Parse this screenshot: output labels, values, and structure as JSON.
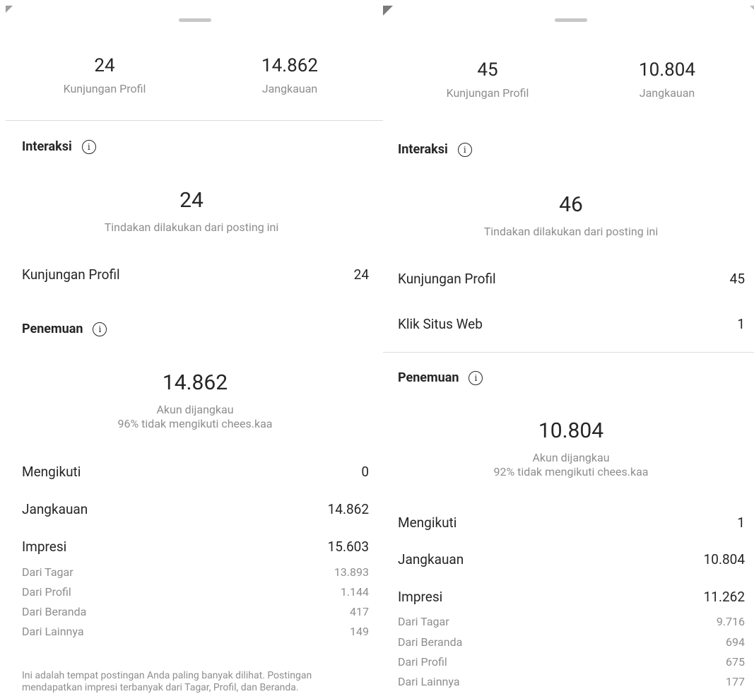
{
  "left": {
    "top_stats": [
      {
        "value": "24",
        "label": "Kunjungan Profil"
      },
      {
        "value": "14.862",
        "label": "Jangkauan"
      }
    ],
    "interaksi": {
      "title": "Interaksi",
      "total": "24",
      "subtitle": "Tindakan dilakukan dari posting ini",
      "rows": [
        {
          "label": "Kunjungan Profil",
          "value": "24"
        }
      ]
    },
    "penemuan": {
      "title": "Penemuan",
      "total": "14.862",
      "subtitle1": "Akun dijangkau",
      "subtitle2": "96% tidak mengikuti chees.kaa",
      "rows": [
        {
          "label": "Mengikuti",
          "value": "0"
        },
        {
          "label": "Jangkauan",
          "value": "14.862"
        },
        {
          "label": "Impresi",
          "value": "15.603"
        }
      ],
      "sub_rows": [
        {
          "label": "Dari Tagar",
          "value": "13.893"
        },
        {
          "label": "Dari Profil",
          "value": "1.144"
        },
        {
          "label": "Dari Beranda",
          "value": "417"
        },
        {
          "label": "Dari Lainnya",
          "value": "149"
        }
      ],
      "note": "Ini adalah tempat postingan Anda paling banyak dilihat. Postingan mendapatkan impresi terbanyak dari Tagar, Profil, dan Beranda."
    }
  },
  "right": {
    "top_stats": [
      {
        "value": "45",
        "label": "Kunjungan Profil"
      },
      {
        "value": "10.804",
        "label": "Jangkauan"
      }
    ],
    "interaksi": {
      "title": "Interaksi",
      "total": "46",
      "subtitle": "Tindakan dilakukan dari posting ini",
      "rows": [
        {
          "label": "Kunjungan Profil",
          "value": "45"
        },
        {
          "label": "Klik Situs Web",
          "value": "1"
        }
      ]
    },
    "penemuan": {
      "title": "Penemuan",
      "total": "10.804",
      "subtitle1": "Akun dijangkau",
      "subtitle2": "92% tidak mengikuti chees.kaa",
      "rows": [
        {
          "label": "Mengikuti",
          "value": "1"
        },
        {
          "label": "Jangkauan",
          "value": "10.804"
        },
        {
          "label": "Impresi",
          "value": "11.262"
        }
      ],
      "sub_rows": [
        {
          "label": "Dari Tagar",
          "value": "9.716"
        },
        {
          "label": "Dari Beranda",
          "value": "694"
        },
        {
          "label": "Dari Profil",
          "value": "675"
        },
        {
          "label": "Dari Lainnya",
          "value": "177"
        }
      ]
    }
  },
  "icons": {
    "info": "info-icon"
  },
  "colors": {
    "text": "#262626",
    "secondary": "#8e8e8e",
    "divider": "#dbdbdb"
  }
}
